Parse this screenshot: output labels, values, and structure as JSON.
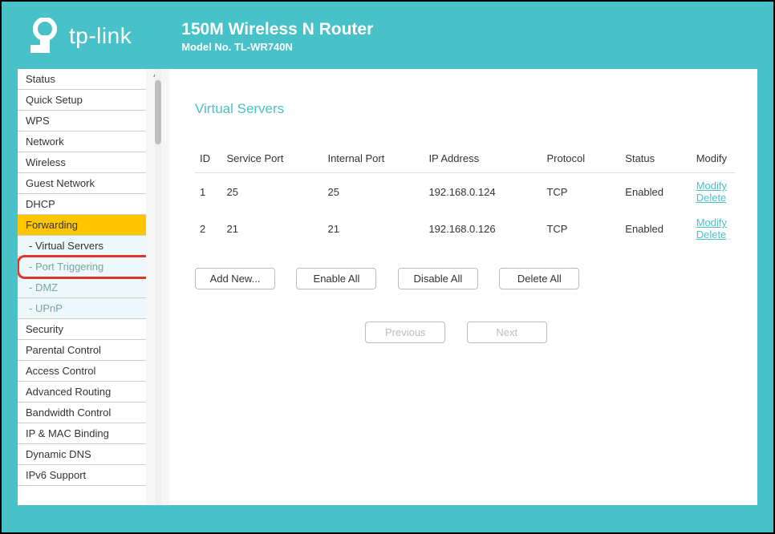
{
  "brand": {
    "name": "tp-link"
  },
  "header": {
    "title": "150M Wireless N Router",
    "subtitle": "Model No. TL-WR740N"
  },
  "sidebar": {
    "items": [
      {
        "label": "Status",
        "type": "item"
      },
      {
        "label": "Quick Setup",
        "type": "item"
      },
      {
        "label": "WPS",
        "type": "item"
      },
      {
        "label": "Network",
        "type": "item"
      },
      {
        "label": "Wireless",
        "type": "item"
      },
      {
        "label": "Guest Network",
        "type": "item"
      },
      {
        "label": "DHCP",
        "type": "item"
      },
      {
        "label": "Forwarding",
        "type": "active"
      },
      {
        "label": "- Virtual Servers",
        "type": "sub-selected"
      },
      {
        "label": "- Port Triggering",
        "type": "sub-highlight"
      },
      {
        "label": "- DMZ",
        "type": "sub"
      },
      {
        "label": "- UPnP",
        "type": "sub"
      },
      {
        "label": "Security",
        "type": "item"
      },
      {
        "label": "Parental Control",
        "type": "item"
      },
      {
        "label": "Access Control",
        "type": "item"
      },
      {
        "label": "Advanced Routing",
        "type": "item"
      },
      {
        "label": "Bandwidth Control",
        "type": "item"
      },
      {
        "label": "IP & MAC Binding",
        "type": "item"
      },
      {
        "label": "Dynamic DNS",
        "type": "item"
      },
      {
        "label": "IPv6 Support",
        "type": "item"
      }
    ]
  },
  "page": {
    "title": "Virtual Servers",
    "columns": {
      "id": "ID",
      "service_port": "Service Port",
      "internal_port": "Internal Port",
      "ip": "IP Address",
      "protocol": "Protocol",
      "status": "Status",
      "modify": "Modify"
    },
    "rows": [
      {
        "id": "1",
        "service_port": "25",
        "internal_port": "25",
        "ip": "192.168.0.124",
        "protocol": "TCP",
        "status": "Enabled"
      },
      {
        "id": "2",
        "service_port": "21",
        "internal_port": "21",
        "ip": "192.168.0.126",
        "protocol": "TCP",
        "status": "Enabled"
      }
    ],
    "actions": {
      "modify": "Modify",
      "delete": "Delete",
      "add_new": "Add New...",
      "enable_all": "Enable All",
      "disable_all": "Disable All",
      "delete_all": "Delete All",
      "previous": "Previous",
      "next": "Next"
    }
  }
}
